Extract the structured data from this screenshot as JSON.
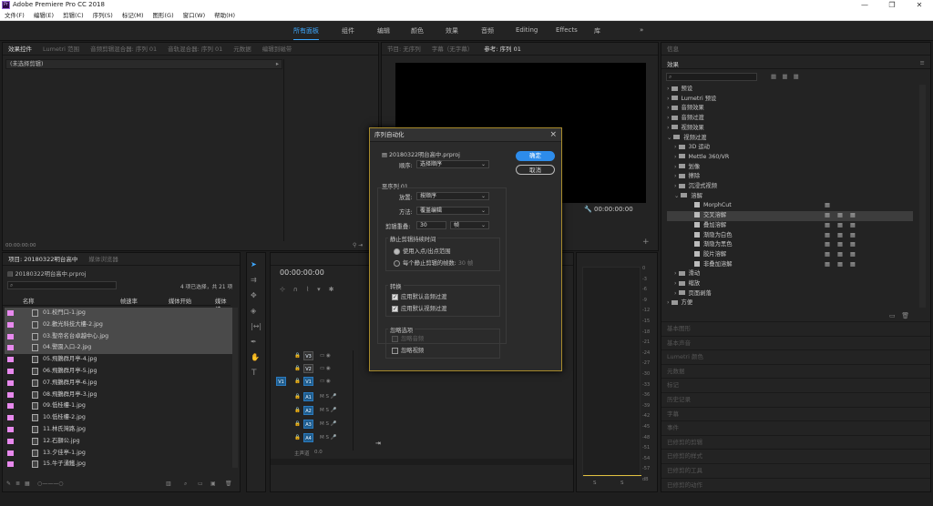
{
  "app": {
    "title": "Adobe Premiere Pro CC 2018",
    "icon": "Pr"
  },
  "menu": [
    "文件(F)",
    "编辑(E)",
    "剪辑(C)",
    "序列(S)",
    "标记(M)",
    "图形(G)",
    "窗口(W)",
    "帮助(H)"
  ],
  "workspaces": [
    "所有面板",
    "组件",
    "编辑",
    "颜色",
    "效果",
    "音频",
    "Editing",
    "Effects",
    "库"
  ],
  "workspace_overflow": "»",
  "source_panel": {
    "tabs": [
      "效果控件",
      "Lumetri 范围",
      "音频剪辑混合器: 序列 01",
      "音轨混合器: 序列 01",
      "元数据",
      "编辑到磁带"
    ],
    "no_clip": "(未选择剪辑)",
    "timecode": "00:00:00:00"
  },
  "program_panel": {
    "tabs": [
      "节目: 无序列",
      "字幕（无字幕）",
      "参考: 序列 01"
    ],
    "timecode": "00:00:00:00",
    "add": "+"
  },
  "project_panel": {
    "tabs": [
      "项目: 20180322明台高中",
      "媒体浏览器"
    ],
    "project_name": "20180322明台高中.prproj",
    "count": "4 项已选择，共 21 项",
    "columns": [
      "名称",
      "帧速率",
      "媒体开始",
      "媒体结"
    ],
    "items": [
      "01.校門口-1.jpg",
      "02.歡光科技大樓-2.jpg",
      "03.聖帝名台卓越中心.jpg",
      "04.警園入口-2.jpg",
      "05.飛鵝群月亭-4.jpg",
      "06.飛鵝群月亭-5.jpg",
      "07.飛鵝群月亭-6.jpg",
      "08.飛鵝群月亭-3.jpg",
      "09.低桂樓-1.jpg",
      "10.低桂樓-2.jpg",
      "11.林氏灣路.jpg",
      "12.石獅公.jpg",
      "13.夕佳亭-1.jpg",
      "15.牛子湧鐵.jpg"
    ],
    "selected_count": 4
  },
  "timeline": {
    "timecode": "00:00:00:00",
    "video_tracks": [
      "V3",
      "V2",
      "V1"
    ],
    "audio_tracks": [
      "A1",
      "A2",
      "A3",
      "A4"
    ],
    "master": "主声道",
    "master_value": "0.0",
    "source_patch_v": "V1",
    "source_patch_a": "A1",
    "track_toggles": [
      "M",
      "S"
    ]
  },
  "meter": {
    "ticks": [
      "0",
      "-3",
      "-6",
      "-9",
      "-12",
      "-15",
      "-18",
      "-21",
      "-24",
      "-27",
      "-30",
      "-33",
      "-36",
      "-39",
      "-42",
      "-45",
      "-48",
      "-51",
      "-54",
      "-57",
      "dB"
    ],
    "bottom": [
      "S",
      "S"
    ]
  },
  "effects_panel": {
    "tabs": [
      "信息",
      "效果"
    ],
    "items": [
      {
        "label": "预设",
        "depth": 0,
        "open": false
      },
      {
        "label": "Lumetri 预设",
        "depth": 0,
        "open": false
      },
      {
        "label": "音频效果",
        "depth": 0,
        "open": false
      },
      {
        "label": "音频过渡",
        "depth": 0,
        "open": false
      },
      {
        "label": "视频效果",
        "depth": 0,
        "open": false
      },
      {
        "label": "视频过渡",
        "depth": 0,
        "open": true
      },
      {
        "label": "3D 运动",
        "depth": 1,
        "open": false
      },
      {
        "label": "Mettle 360/VR",
        "depth": 1,
        "open": false
      },
      {
        "label": "划像",
        "depth": 1,
        "open": false
      },
      {
        "label": "擦除",
        "depth": 1,
        "open": false
      },
      {
        "label": "沉浸式视频",
        "depth": 1,
        "open": false
      },
      {
        "label": "溶解",
        "depth": 1,
        "open": true
      },
      {
        "label": "MorphCut",
        "depth": 2,
        "open": false
      },
      {
        "label": "交叉溶解",
        "depth": 2,
        "open": false,
        "selected": true
      },
      {
        "label": "叠加溶解",
        "depth": 2,
        "open": false
      },
      {
        "label": "渐隐为白色",
        "depth": 2,
        "open": false
      },
      {
        "label": "渐隐为黑色",
        "depth": 2,
        "open": false
      },
      {
        "label": "胶片溶解",
        "depth": 2,
        "open": false
      },
      {
        "label": "非叠加溶解",
        "depth": 2,
        "open": false
      },
      {
        "label": "滑动",
        "depth": 1,
        "open": false
      },
      {
        "label": "缩放",
        "depth": 1,
        "open": false
      },
      {
        "label": "页面剥落",
        "depth": 1,
        "open": false
      },
      {
        "label": "方便",
        "depth": 0,
        "open": false
      }
    ],
    "sections": [
      "基本图形",
      "基本声音",
      "Lumetri 颜色",
      "元数据",
      "标记",
      "历史记录",
      "字幕",
      "事件",
      "已修剪的剪辑",
      "已修剪的样式",
      "已修剪的工具",
      "已修剪的动作"
    ]
  },
  "dialog": {
    "title": "序列自动化",
    "project": "20180322明台高中.prproj",
    "order_label": "顺序:",
    "order_value": "选择顺序",
    "to_sequence": "至序列 01",
    "placement_label": "放置:",
    "placement_value": "按顺序",
    "method_label": "方法:",
    "method_value": "覆盖编辑",
    "overlap_label": "剪辑重叠:",
    "overlap_value": "30",
    "overlap_unit": "帧",
    "still_group": "静止剪辑持续时间",
    "use_inout": "使用入点/出点范围",
    "per_still": "每个静止剪辑的帧数:",
    "per_still_value": "30",
    "per_still_unit": "帧",
    "transitions": "转换",
    "apply_audio": "应用默认音频过渡",
    "apply_video": "应用默认视频过渡",
    "ignore_group": "忽略选项",
    "ignore_audio": "忽略音频",
    "ignore_video": "忽略视频",
    "ok": "确定",
    "cancel": "取消",
    "close": "×"
  },
  "colors": {
    "accent": "#3ea8ff",
    "label_pink": "#e889ee",
    "dialog_border": "#a88b2c",
    "ok_button": "#2d8ceb"
  }
}
